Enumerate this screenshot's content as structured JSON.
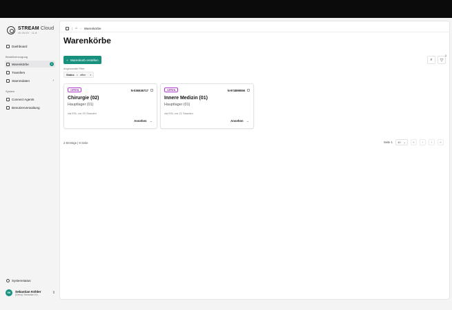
{
  "app": {
    "brand_name": "STREAM",
    "brand_name_light": "Cloud",
    "brand_version": "v0.00.00 · 11.8"
  },
  "sidebar": {
    "dashboard": "Dashboard",
    "section_ordering": "Bestellversorgung",
    "items": [
      {
        "label": "Warenkörbe",
        "badge": "2"
      },
      {
        "label": "Transfers"
      },
      {
        "label": "Stammdaten"
      }
    ],
    "section_system": "System",
    "system_items": [
      {
        "label": "Connect Agents"
      },
      {
        "label": "Benutzerverwaltung"
      }
    ],
    "system_status": "Systemstatus",
    "user": {
      "initials": "SK",
      "name": "Sebastian Köhler",
      "subtitle": "(Demo) Sebastian Kö..."
    }
  },
  "breadcrumb": {
    "current": "Warenkörbe"
  },
  "page": {
    "title": "Warenkörbe",
    "create_button": "Warenkorb erstellen",
    "filter_count": "1",
    "applied_filters_label": "Angewandte Filter",
    "filter_key": "Status",
    "filter_op": "=",
    "filter_value": "offen",
    "summary": "2 Einträge | 8 Seite",
    "pager": {
      "label": "Seite 1",
      "page_size": "10"
    }
  },
  "cards": [
    {
      "status": "OFFEN",
      "id": "N-036536717",
      "title": "Chirurgie (02)",
      "subtitle": "Hauptlager (01)",
      "meta": "via ESL vor 20 Stunden",
      "action": "Ansehen"
    },
    {
      "status": "OFFEN",
      "id": "N-974899556",
      "title": "Innere Medizin (01)",
      "subtitle": "Hauptlager (01)",
      "meta": "via ESL vor 21 Stunden",
      "action": "Ansehen"
    }
  ]
}
